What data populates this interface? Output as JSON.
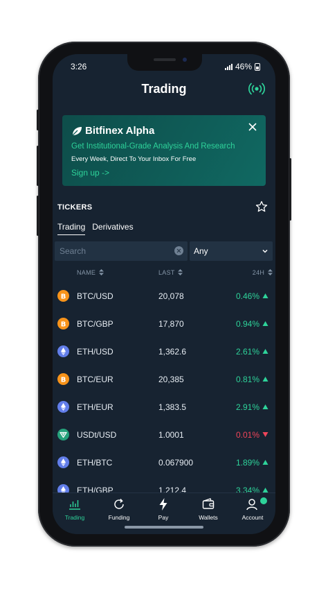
{
  "status_bar": {
    "time": "3:26",
    "battery": "46%"
  },
  "header": {
    "title": "Trading",
    "live_icon": "broadcast-icon"
  },
  "banner": {
    "title": "Bitfinex Alpha",
    "subtitle": "Get Institutional-Grade Analysis And Research",
    "body": "Every Week, Direct To Your Inbox For Free",
    "cta": "Sign up ->"
  },
  "tickers": {
    "title": "TICKERS",
    "tabs": [
      {
        "label": "Trading",
        "active": true
      },
      {
        "label": "Derivatives",
        "active": false
      }
    ],
    "search_placeholder": "Search",
    "filter_value": "Any",
    "columns": {
      "name": "NAME",
      "last": "LAST",
      "change": "24H"
    },
    "rows": [
      {
        "pair": "BTC/USD",
        "last": "20,078",
        "change": "0.46%",
        "direction": "up",
        "coin": "btc"
      },
      {
        "pair": "BTC/GBP",
        "last": "17,870",
        "change": "0.94%",
        "direction": "up",
        "coin": "btc"
      },
      {
        "pair": "ETH/USD",
        "last": "1,362.6",
        "change": "2.61%",
        "direction": "up",
        "coin": "eth"
      },
      {
        "pair": "BTC/EUR",
        "last": "20,385",
        "change": "0.81%",
        "direction": "up",
        "coin": "btc"
      },
      {
        "pair": "ETH/EUR",
        "last": "1,383.5",
        "change": "2.91%",
        "direction": "up",
        "coin": "eth"
      },
      {
        "pair": "USDt/USD",
        "last": "1.0001",
        "change": "0.01%",
        "direction": "down",
        "coin": "usdt"
      },
      {
        "pair": "ETH/BTC",
        "last": "0.067900",
        "change": "1.89%",
        "direction": "up",
        "coin": "eth"
      },
      {
        "pair": "ETH/GBP",
        "last": "1,212.4",
        "change": "3.34%",
        "direction": "up",
        "coin": "eth"
      }
    ]
  },
  "tabbar": {
    "items": [
      {
        "label": "Trading",
        "icon": "chart-icon",
        "active": true
      },
      {
        "label": "Funding",
        "icon": "refresh-icon",
        "active": false
      },
      {
        "label": "Pay",
        "icon": "lightning-icon",
        "active": false
      },
      {
        "label": "Wallets",
        "icon": "wallet-icon",
        "active": false
      },
      {
        "label": "Account",
        "icon": "user-icon",
        "active": false
      }
    ]
  },
  "colors": {
    "background": "#172331",
    "accent": "#2ed39a",
    "negative": "#f0455a",
    "btc": "#f7931a",
    "eth": "#627eea",
    "usdt": "#26a17b"
  }
}
